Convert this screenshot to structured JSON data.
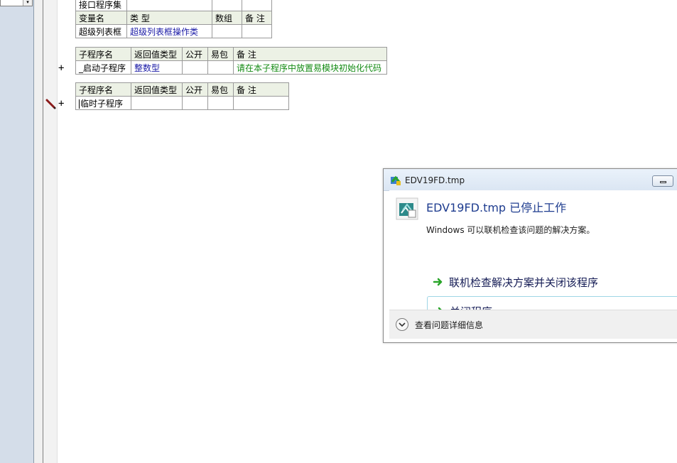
{
  "table1": {
    "row0": {
      "c1": "接口程序集",
      "c2": "",
      "c3": "",
      "c4": ""
    },
    "header": {
      "c1": "变量名",
      "c2": "类 型",
      "c3": "数组",
      "c4": "备 注"
    },
    "row1": {
      "c1": "超级列表框",
      "c2": "超级列表框操作类",
      "c3": "",
      "c4": ""
    }
  },
  "table2": {
    "header": {
      "c1": "子程序名",
      "c2": "返回值类型",
      "c3": "公开",
      "c4": "易包",
      "c5": "备 注"
    },
    "row1": {
      "c1": "_启动子程序",
      "c2": "整数型",
      "c3": "",
      "c4": "",
      "c5": "请在本子程序中放置易模块初始化代码"
    }
  },
  "table3": {
    "header": {
      "c1": "子程序名",
      "c2": "返回值类型",
      "c3": "公开",
      "c4": "易包",
      "c5": "备 注"
    },
    "row1": {
      "c1": "临时子程序",
      "c2": "",
      "c3": "",
      "c4": "",
      "c5": ""
    }
  },
  "gutter": {
    "plus": "+"
  },
  "dialog": {
    "title": "EDV19FD.tmp",
    "main_instruction": "EDV19FD.tmp 已停止工作",
    "content": "Windows 可以联机检查该问题的解决方案。",
    "cmd_online": "联机检查解决方案并关闭该程序",
    "cmd_close": "关闭程序",
    "details": "查看问题详细信息"
  },
  "colors": {
    "accent_blue": "#1e3c8f",
    "code_green": "#138a13",
    "code_blue": "#1a1aa6",
    "header_bg": "#ecf1e5",
    "arrow_green": "#2aa52a"
  },
  "icons": {
    "breakpoint": "pencil-icon",
    "title": "error-app-icon",
    "app": "stopped-app-icon",
    "command": "green-arrow-icon",
    "details": "chevron-down-icon"
  }
}
